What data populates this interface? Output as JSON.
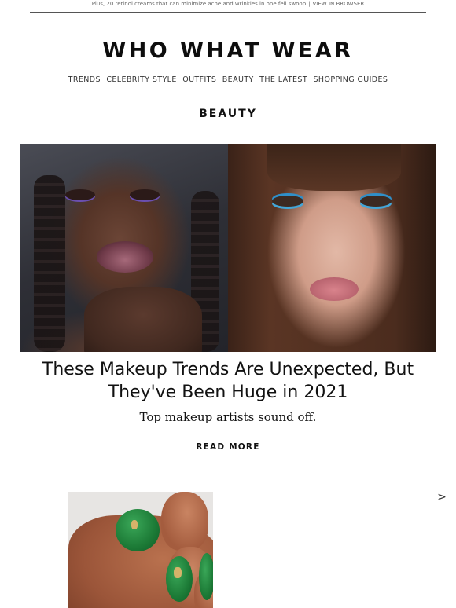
{
  "preheader": {
    "text": "Plus, 20 retinol creams that can minimize acne and wrinkles in one fell swoop",
    "separator": "|",
    "view_in_browser": "VIEW IN BROWSER"
  },
  "header": {
    "logo": "WHO WHAT WEAR"
  },
  "nav": {
    "items": [
      "TRENDS",
      "CELEBRITY STYLE",
      "OUTFITS",
      "BEAUTY",
      "THE LATEST",
      "SHOPPING GUIDES"
    ]
  },
  "section": {
    "title": "BEAUTY"
  },
  "feature": {
    "headline": "These Makeup Trends Are Unexpected, But They've Been Huge in 2021",
    "dek": "Top makeup artists sound off.",
    "cta": "READ MORE"
  },
  "next_card": {
    "arrow": ">"
  }
}
